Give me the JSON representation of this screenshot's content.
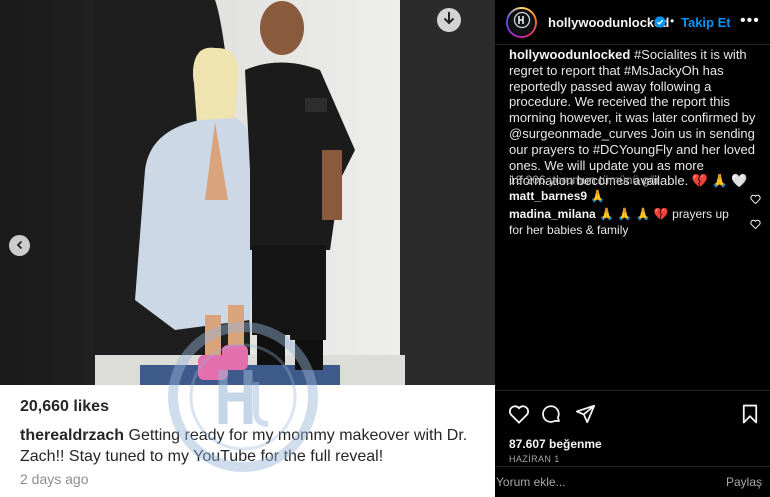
{
  "post": {
    "likes": "20,660 likes",
    "caption_user": "therealdrzach",
    "caption_text": " Getting ready for my mommy makeover with Dr. Zach!! Stay tuned to my YouTube for the full reveal!",
    "time_ago": "2 days ago",
    "watermark_icon": "hu-logo-watermark"
  },
  "header": {
    "username": "hollywoodunlocked",
    "separator": "•",
    "follow_label": "Takip Et",
    "more_label": "•••"
  },
  "caption": {
    "username": "hollywoodunlocked",
    "text": " #Socialites it is with regret to report that #MsJackyOh has reportedly passed away following a procedure. We received the report this morning however, it was later confirmed by @surgeonmade_curves Join us in sending our prayers to #DCYoungFly and her loved ones. We will update you as more information becomes available. 💔 🙏 🤍"
  },
  "comments": {
    "view_all": "13.306 yorumun tümünü gör",
    "items": [
      {
        "user": "matt_barnes9",
        "text": " 🙏"
      },
      {
        "user": "madina_milana",
        "text": " 🙏 🙏 🙏 💔  prayers up for her babies & family"
      }
    ]
  },
  "footer": {
    "like_count": "87.607 beğenme",
    "date": "HAZİRAN 1",
    "comment_placeholder": "Yorum ekle...",
    "post_label": "Paylaş"
  },
  "colors": {
    "accent": "#0095f6",
    "background": "#000000",
    "muted": "#a8a8a8"
  }
}
